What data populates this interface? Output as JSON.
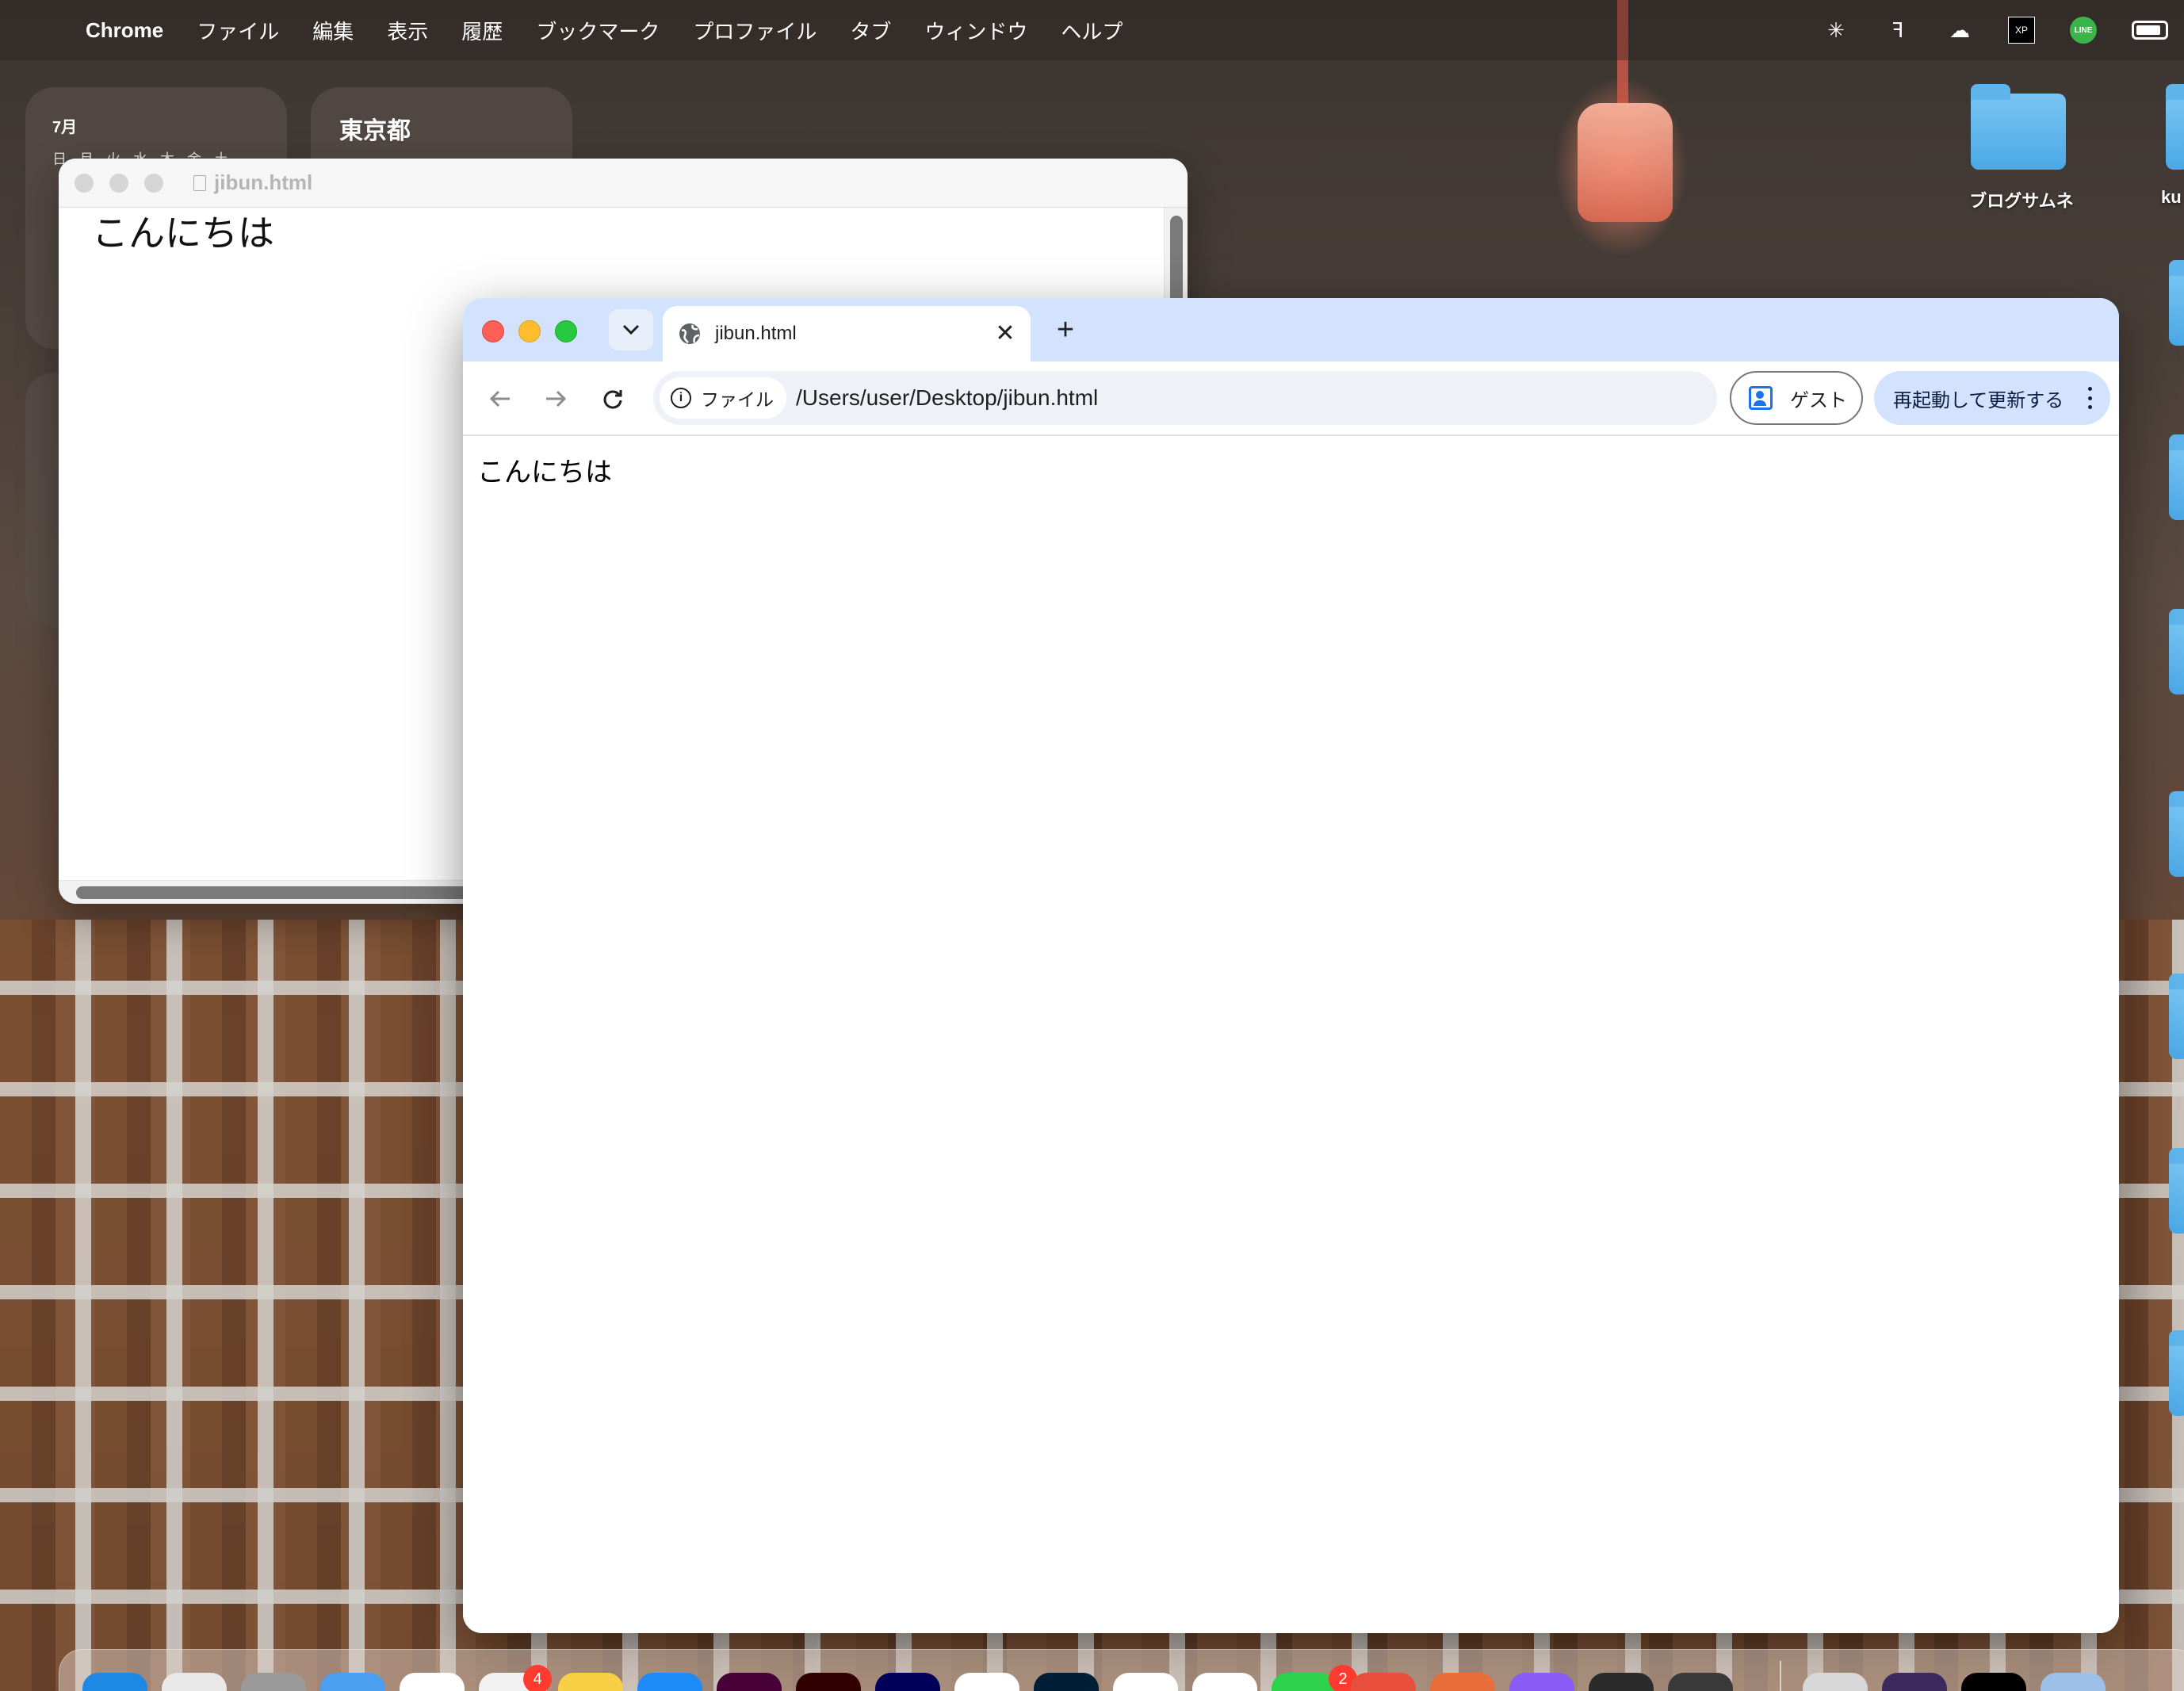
{
  "menubar": {
    "app_name": "Chrome",
    "items": [
      "ファイル",
      "編集",
      "表示",
      "履歴",
      "ブックマーク",
      "プロファイル",
      "タブ",
      "ウィンドウ",
      "ヘルプ"
    ]
  },
  "widgets": {
    "calendar_month": "7月",
    "calendar_days": "日月火水木金土",
    "weather_city": "東京都"
  },
  "desktop": {
    "folders": [
      {
        "label": "ブログサムネ"
      },
      {
        "label": "ku"
      }
    ]
  },
  "bg_window": {
    "title": "jibun.html",
    "content": "こんにちは"
  },
  "chrome": {
    "tab_title": "jibun.html",
    "new_tab": "+",
    "site_chip_label": "ファイル",
    "url": "/Users/user/Desktop/jibun.html",
    "guest_label": "ゲスト",
    "relaunch_label": "再起動して更新する",
    "page_text": "こんにちは"
  },
  "dock": {
    "badges": [
      "4",
      "2"
    ]
  },
  "colors": {
    "tabstrip": "#d3e3fd",
    "close": "#fe5f57",
    "minimize": "#febc2e",
    "maximize": "#28c840",
    "guest_icon": "#1a73e8"
  }
}
